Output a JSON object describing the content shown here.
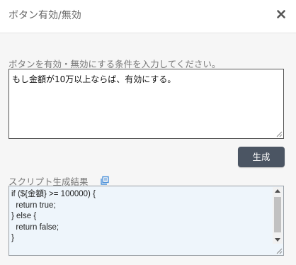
{
  "dialog": {
    "title": "ボタン有効/無効",
    "close_icon": "close-icon"
  },
  "condition": {
    "label": "ボタンを有効・無効にする条件を入力してください。",
    "value": "もし金額が10万以上ならば、有効にする。"
  },
  "generate_button": {
    "label": "生成"
  },
  "result": {
    "label": "スクリプト生成結果",
    "copy_icon": "copy-icon",
    "code": "if (${金額} >= 100000) {\n  return true;\n} else {\n  return false;\n}"
  },
  "colors": {
    "button_bg": "#4b5563",
    "result_bg": "#eef5fb",
    "accent": "#4a90d9"
  }
}
